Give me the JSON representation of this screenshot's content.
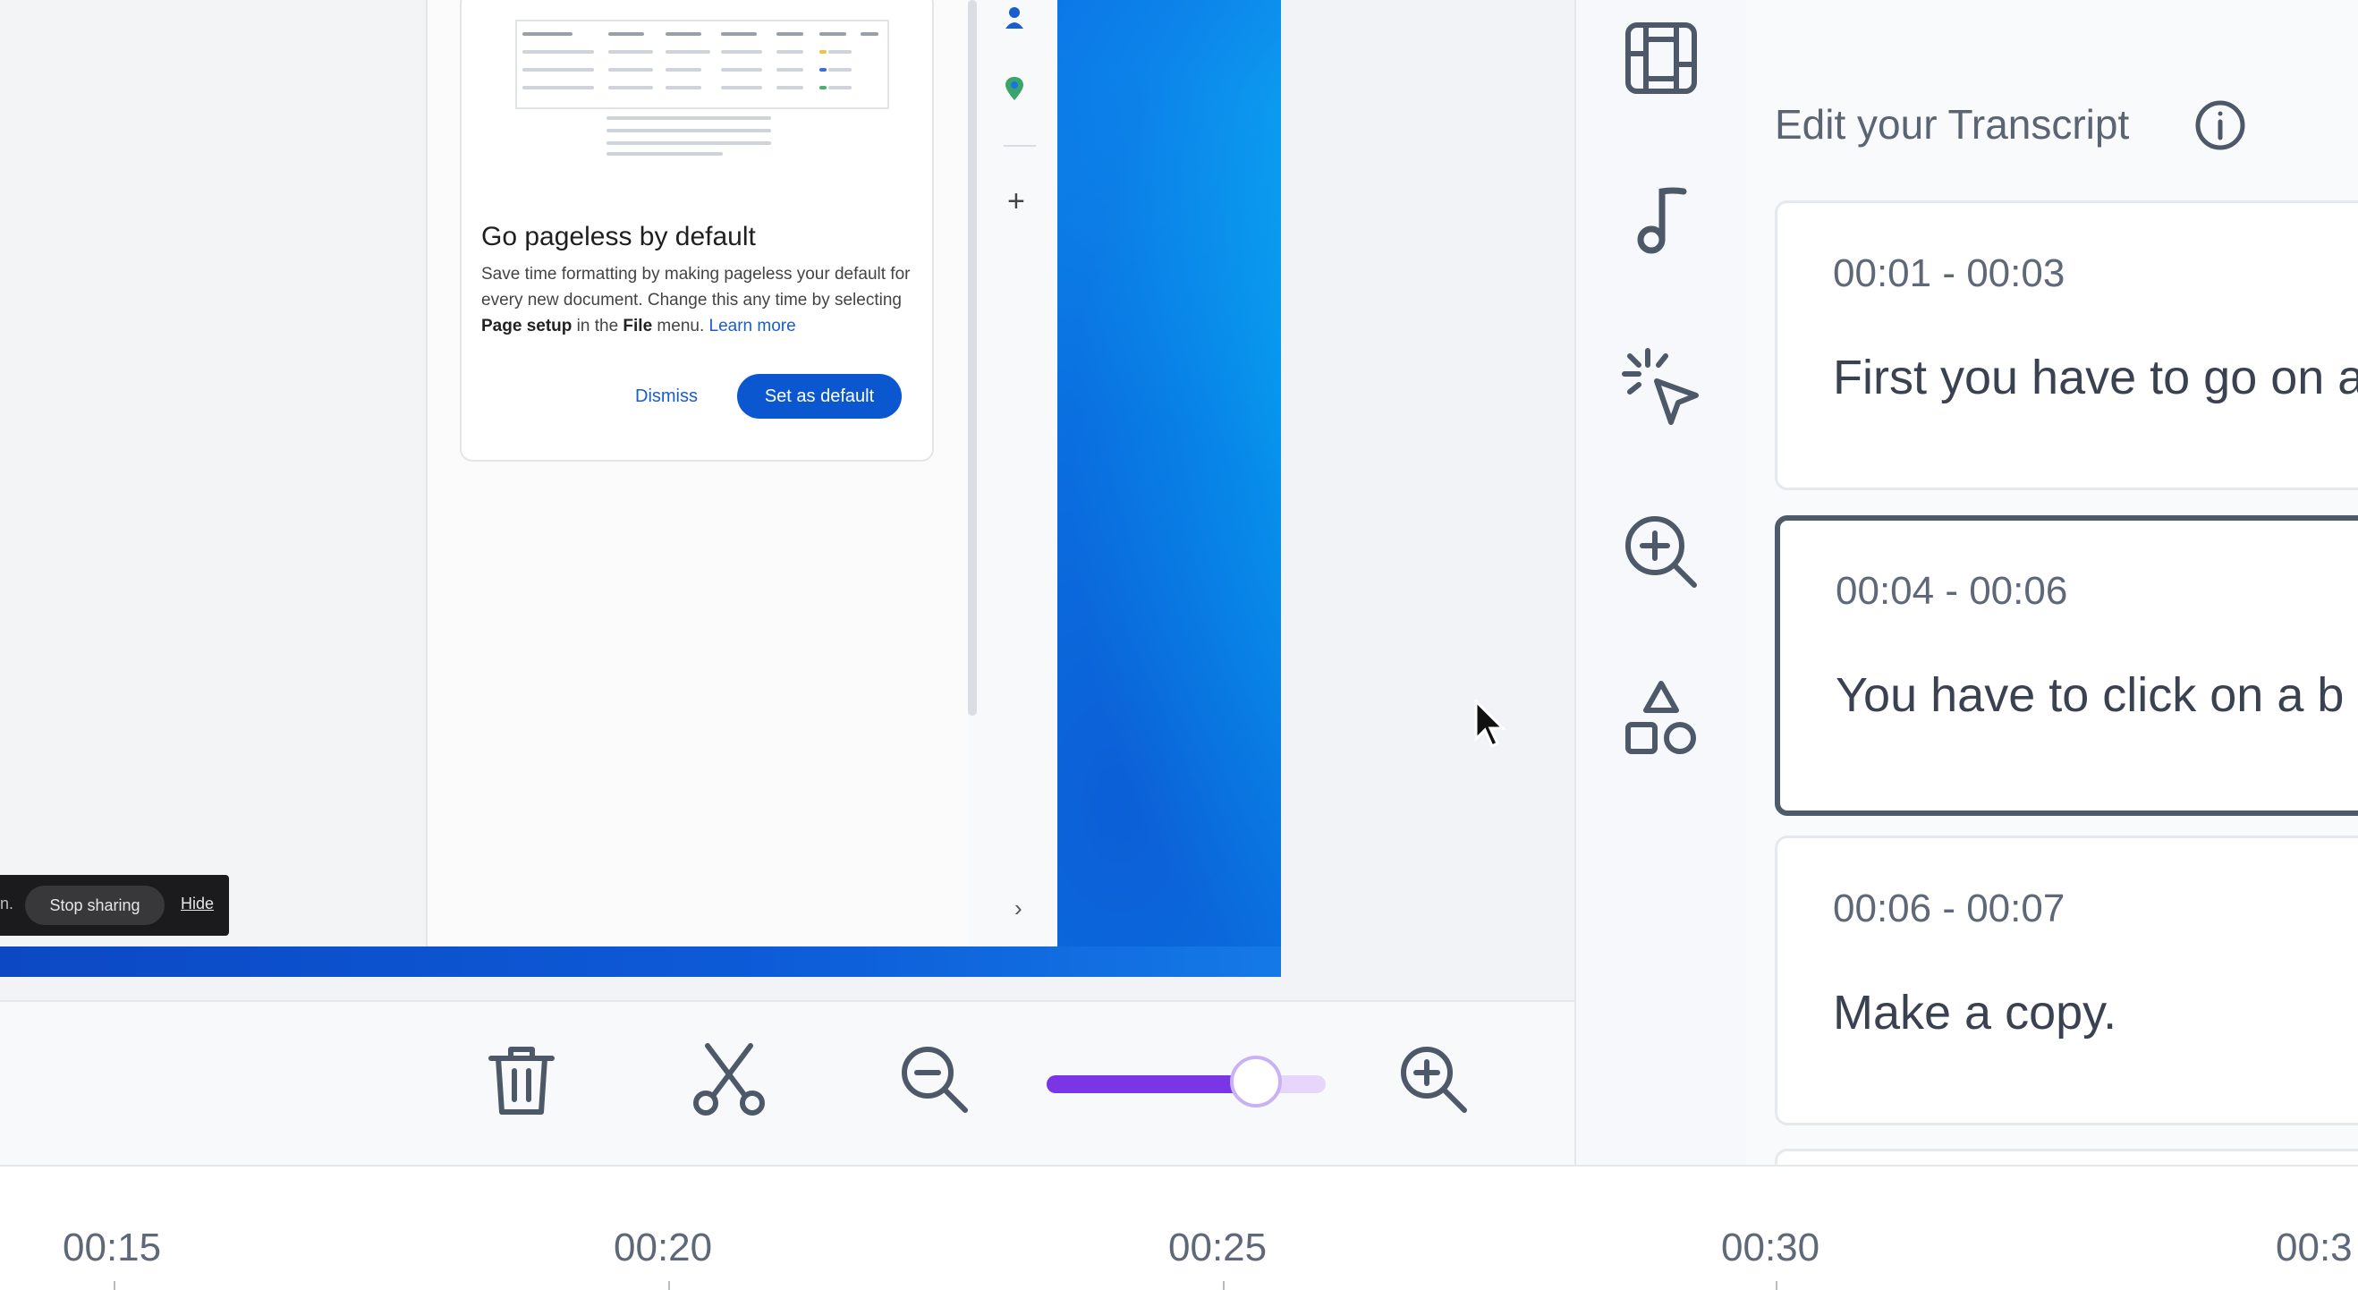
{
  "preview": {
    "share_bar": {
      "stop_label": "Stop sharing",
      "hide_label": "Hide",
      "truncated_prefix": "n."
    },
    "doc_card": {
      "title": "Go pageless by default",
      "body_part1": "Save time formatting by making pageless your default for every new document. Change this any time by selecting ",
      "body_bold1": "Page setup",
      "body_part2": " in the ",
      "body_bold2": "File",
      "body_part3": " menu. ",
      "learn_more": "Learn more",
      "dismiss_label": "Dismiss",
      "default_label": "Set as default"
    },
    "rail": {
      "plus": "+",
      "chevron": "›"
    }
  },
  "tools": [
    "layout-icon",
    "music-note-icon",
    "click-effect-icon",
    "zoom-in-icon",
    "shapes-icon"
  ],
  "transcript": {
    "title": "Edit your Transcript",
    "segments": [
      {
        "time": "00:01 - 00:03",
        "text": "First you have to go on a",
        "active": false
      },
      {
        "time": "00:04 - 00:06",
        "text": "You have to click on a b",
        "active": true
      },
      {
        "time": "00:06 - 00:07",
        "text": "Make a copy.",
        "active": false
      }
    ]
  },
  "toolbar": {
    "zoom_level": 0.75
  },
  "timeline": {
    "ticks": [
      "00:15",
      "00:20",
      "00:25",
      "00:30",
      "00:3"
    ]
  },
  "colors": {
    "accent": "#7a35e6",
    "active_border": "#4d5a6b",
    "google_blue": "#0b57d0"
  }
}
